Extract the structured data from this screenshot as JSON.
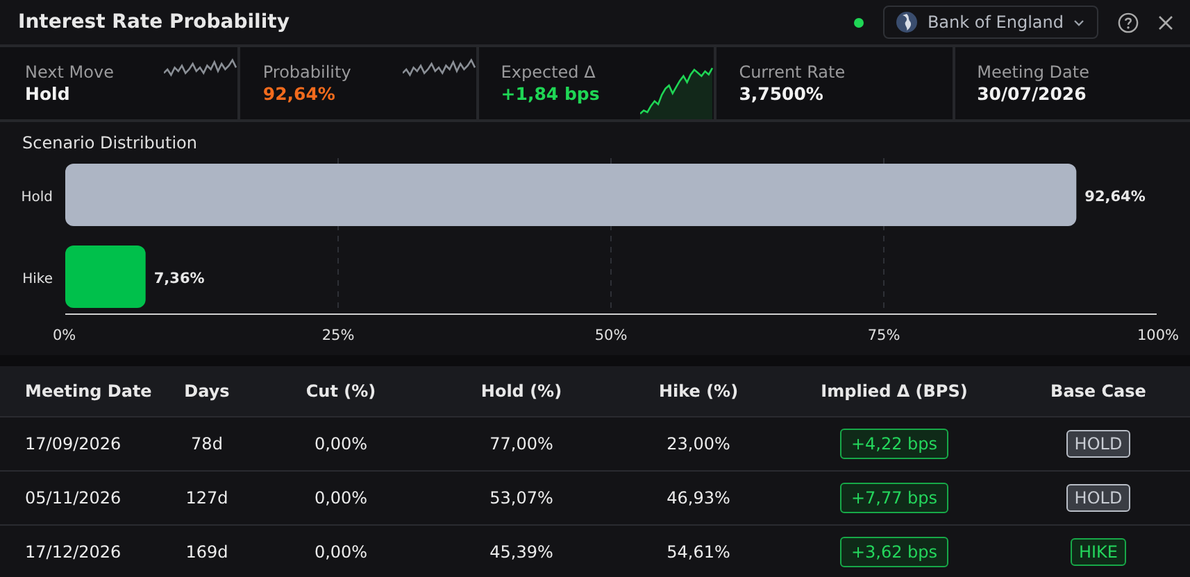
{
  "window": {
    "title": "Interest Rate Probability",
    "live": true,
    "source": "Bank of England"
  },
  "stats": [
    {
      "label": "Next Move",
      "value": "Hold",
      "color": "#f2f2f2",
      "kind": "flat"
    },
    {
      "label": "Probability",
      "value": "92,64%",
      "color": "#f26b1d",
      "kind": "flat"
    },
    {
      "label": "Expected Δ",
      "value": "+1,84 bps",
      "color": "#1fd655",
      "kind": "rising"
    },
    {
      "label": "Current Rate",
      "value": "3,7500%",
      "color": "#f2f2f2",
      "kind": "plain"
    },
    {
      "label": "Meeting Date",
      "value": "30/07/2026",
      "color": "#f2f2f2",
      "kind": "plain"
    }
  ],
  "distribution": {
    "title": "Scenario Distribution",
    "chart_data": {
      "type": "bar",
      "orientation": "horizontal",
      "grid": true,
      "categories": [
        "Hold",
        "Hike"
      ],
      "series": [
        {
          "values": [
            92.64,
            7.36
          ],
          "colors": [
            "#adb5c4",
            "#00c04b"
          ]
        }
      ],
      "value_labels": [
        "92,64%",
        "7,36%"
      ],
      "xlim": [
        0,
        100
      ],
      "xticks": [
        {
          "value": 0,
          "label": "0%"
        },
        {
          "value": 25,
          "label": "25%"
        },
        {
          "value": 50,
          "label": "50%"
        },
        {
          "value": 75,
          "label": "75%"
        },
        {
          "value": 100,
          "label": "100%"
        }
      ]
    }
  },
  "table": {
    "columns": [
      "Meeting Date",
      "Days",
      "Cut (%)",
      "Hold (%)",
      "Hike (%)",
      "Implied Δ (BPS)",
      "Base Case"
    ],
    "rows": [
      {
        "date": "17/09/2026",
        "days": "78d",
        "cut": "0,00%",
        "hold": "77,00%",
        "hike": "23,00%",
        "implied": "+4,22 bps",
        "base_case": "HOLD",
        "kind": "hold"
      },
      {
        "date": "05/11/2026",
        "days": "127d",
        "cut": "0,00%",
        "hold": "53,07%",
        "hike": "46,93%",
        "implied": "+7,77 bps",
        "base_case": "HOLD",
        "kind": "hold"
      },
      {
        "date": "17/12/2026",
        "days": "169d",
        "cut": "0,00%",
        "hold": "45,39%",
        "hike": "54,61%",
        "implied": "+3,62 bps",
        "base_case": "HIKE",
        "kind": "hike"
      }
    ]
  }
}
